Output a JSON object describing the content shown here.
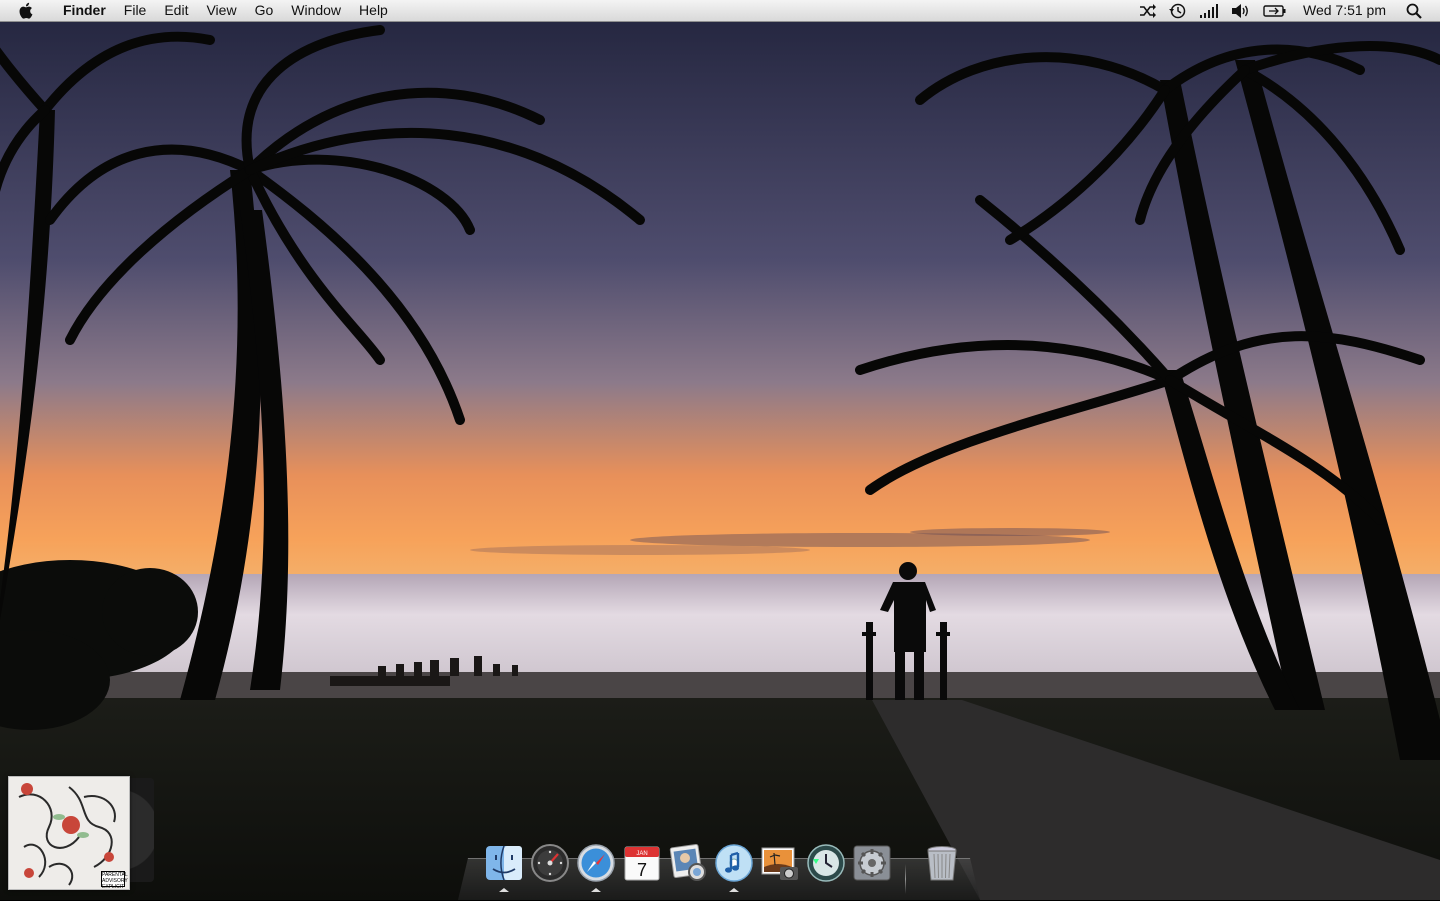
{
  "menubar": {
    "app_name": "Finder",
    "menus": [
      "File",
      "Edit",
      "View",
      "Go",
      "Window",
      "Help"
    ],
    "clock": "Wed 7:51 pm",
    "status_icons": [
      "shuffle-icon",
      "time-machine-icon",
      "signal-bars-icon",
      "volume-icon",
      "battery-icon",
      "spotlight-icon"
    ]
  },
  "now_playing": {
    "parental_label": "PARENTAL ADVISORY EXPLICIT CONTENT"
  },
  "dock": {
    "apps": [
      {
        "name": "finder-dock-icon",
        "running": true
      },
      {
        "name": "dashboard-dock-icon",
        "running": false
      },
      {
        "name": "safari-dock-icon",
        "running": true
      },
      {
        "name": "ical-dock-icon",
        "running": false,
        "month": "JAN",
        "day": "7"
      },
      {
        "name": "iphoto-viewer-dock-icon",
        "running": false
      },
      {
        "name": "itunes-dock-icon",
        "running": true
      },
      {
        "name": "iphoto-dock-icon",
        "running": false
      },
      {
        "name": "time-machine-dock-icon",
        "running": false
      },
      {
        "name": "system-preferences-dock-icon",
        "running": false
      },
      {
        "name": "trash-dock-icon",
        "running": false
      }
    ]
  },
  "colors": {
    "sky_top": "#2a2c4a",
    "sky_mid": "#5a5778",
    "horizon": "#f08a3c",
    "sea": "#d8cfd6",
    "grass": "#1b1e16"
  }
}
